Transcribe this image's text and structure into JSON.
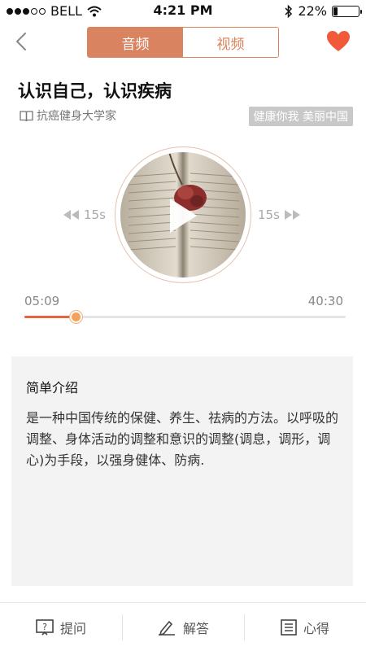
{
  "status_bar": {
    "carrier": "BELL",
    "time": "4:21 PM",
    "battery_text": "22%",
    "battery_level": 0.22
  },
  "nav": {
    "tabs": [
      {
        "label": "音频",
        "active": true
      },
      {
        "label": "视频",
        "active": false
      }
    ]
  },
  "content": {
    "title": "认识自己，认识疾病",
    "source": "抗癌健身大学家",
    "tag": "健康你我 美丽中国"
  },
  "player": {
    "skip_back_label": "15s",
    "skip_forward_label": "15s",
    "current_time": "05:09",
    "total_time": "40:30",
    "progress": 0.16
  },
  "intro": {
    "title": "简单介绍",
    "body": "是一种中国传统的保健、养生、祛病的方法。以呼吸的调整、身体活动的调整和意识的调整(调息，调形，调心)为手段，以强身健体、防病."
  },
  "bottom_bar": {
    "ask_label": "提问",
    "answer_label": "解答",
    "notes_label": "心得"
  },
  "colors": {
    "accent": "#d98360",
    "progress": "#e7643f",
    "heart": "#f05a3a"
  }
}
